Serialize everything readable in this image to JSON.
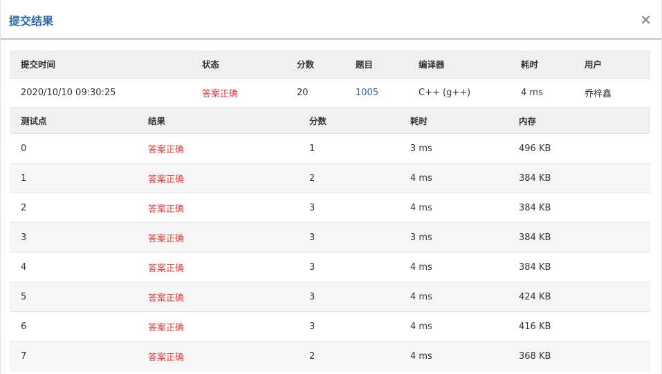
{
  "dialog": {
    "title": "提交结果",
    "close_glyph": "×"
  },
  "submission": {
    "headers": [
      "提交时间",
      "状态",
      "分数",
      "题目",
      "编译器",
      "耗时",
      "用户"
    ],
    "time": "2020/10/10 09:30:25",
    "status": "答案正确",
    "score": "20",
    "problem": "1005",
    "compiler": "C++ (g++)",
    "elapsed": "4 ms",
    "user": "乔梓鑫"
  },
  "testcases": {
    "headers": [
      "测试点",
      "结果",
      "分数",
      "耗时",
      "内存"
    ],
    "rows": [
      {
        "id": "0",
        "result": "答案正确",
        "score": "1",
        "time": "3 ms",
        "memory": "496 KB"
      },
      {
        "id": "1",
        "result": "答案正确",
        "score": "2",
        "time": "4 ms",
        "memory": "384 KB"
      },
      {
        "id": "2",
        "result": "答案正确",
        "score": "3",
        "time": "4 ms",
        "memory": "384 KB"
      },
      {
        "id": "3",
        "result": "答案正确",
        "score": "3",
        "time": "3 ms",
        "memory": "384 KB"
      },
      {
        "id": "4",
        "result": "答案正确",
        "score": "3",
        "time": "4 ms",
        "memory": "384 KB"
      },
      {
        "id": "5",
        "result": "答案正确",
        "score": "3",
        "time": "4 ms",
        "memory": "424 KB"
      },
      {
        "id": "6",
        "result": "答案正确",
        "score": "3",
        "time": "4 ms",
        "memory": "416 KB"
      },
      {
        "id": "7",
        "result": "答案正确",
        "score": "2",
        "time": "4 ms",
        "memory": "368 KB"
      }
    ]
  },
  "colors": {
    "accepted": "#e84040",
    "link": "#2b5fa8",
    "title": "#2b6cb0"
  }
}
